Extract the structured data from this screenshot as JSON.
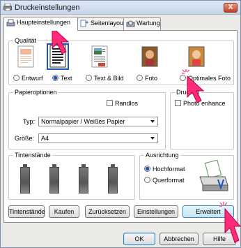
{
  "window": {
    "title": "Druckeinstellungen",
    "close": "X"
  },
  "tabs": [
    "Haupteinstellungen",
    "Seitenlayout",
    "Wartung"
  ],
  "quality": {
    "label": "Qualität",
    "options": [
      "Entwurf",
      "Text",
      "Text & Bild",
      "Foto",
      "Optimales Foto"
    ],
    "selected": "Text"
  },
  "paper": {
    "label": "Papieroptionen",
    "borderless": "Randlos",
    "type_label": "Typ:",
    "type_value": "Normalpapier / Weißes Papier",
    "size_label": "Größe:",
    "size_value": "A4"
  },
  "print_options": {
    "label": "Druckop",
    "photo_enhance": "Photo enhance"
  },
  "ink": {
    "label": "Tintenstände"
  },
  "orientation": {
    "label": "Ausrichtung",
    "portrait": "Hochformat",
    "landscape": "Querformat",
    "selected": "Hochformat"
  },
  "panel_buttons": [
    "Tintenstände",
    "Kaufen",
    "Zurücksetzen",
    "Einstellungen",
    "Erweitert"
  ],
  "footer_buttons": {
    "ok": "OK",
    "cancel": "Abbrechen",
    "help": "Hilfe"
  }
}
